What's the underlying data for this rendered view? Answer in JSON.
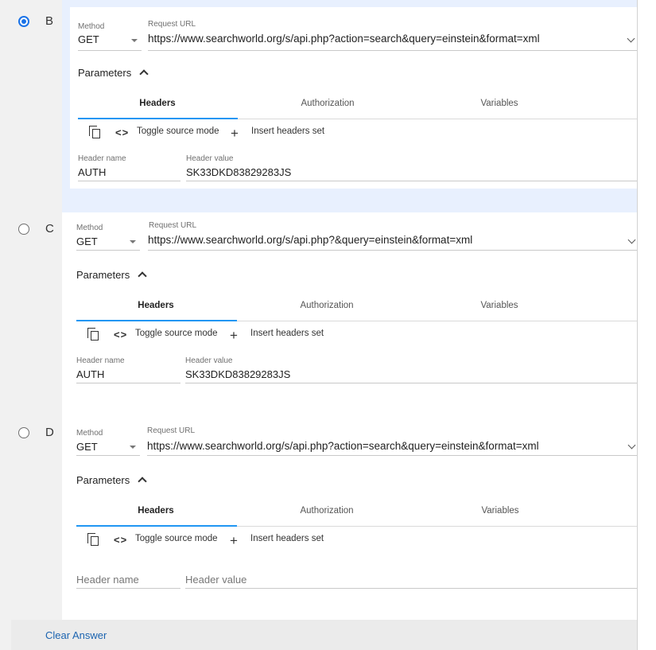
{
  "options": [
    {
      "letter": "B",
      "selected": true,
      "method_label": "Method",
      "method_value": "GET",
      "url_label": "Request URL",
      "url_value": "https://www.searchworld.org/s/api.php?action=search&query=einstein&format=xml",
      "parameters_label": "Parameters",
      "tabs": [
        "Headers",
        "Authorization",
        "Variables"
      ],
      "active_tab": "Headers",
      "toolbar": {
        "toggle_label": "Toggle source mode",
        "insert_label": "Insert headers set"
      },
      "header_name_label": "Header name",
      "header_value_label": "Header value",
      "header_name": "AUTH",
      "header_value": "SK33DKD83829283JS"
    },
    {
      "letter": "C",
      "selected": false,
      "method_label": "Method",
      "method_value": "GET",
      "url_label": "Request URL",
      "url_value": "https://www.searchworld.org/s/api.php?&query=einstein&format=xml",
      "parameters_label": "Parameters",
      "tabs": [
        "Headers",
        "Authorization",
        "Variables"
      ],
      "active_tab": "Headers",
      "toolbar": {
        "toggle_label": "Toggle source mode",
        "insert_label": "Insert headers set"
      },
      "header_name_label": "Header name",
      "header_value_label": "Header value",
      "header_name": "AUTH",
      "header_value": "SK33DKD83829283JS"
    },
    {
      "letter": "D",
      "selected": false,
      "method_label": "Method",
      "method_value": "GET",
      "url_label": "Request URL",
      "url_value": "https://www.searchworld.org/s/api.php?action=search&query=einstein&format=xml",
      "parameters_label": "Parameters",
      "tabs": [
        "Headers",
        "Authorization",
        "Variables"
      ],
      "active_tab": "Headers",
      "toolbar": {
        "toggle_label": "Toggle source mode",
        "insert_label": "Insert headers set"
      },
      "header_name_placeholder": "Header name",
      "header_value_placeholder": "Header value"
    }
  ],
  "clear_answer_label": "Clear Answer",
  "colors": {
    "accent": "#2196f3",
    "radio_selected": "#1a73e8",
    "selected_bg": "#e8f0fe",
    "link": "#1c64b0"
  }
}
